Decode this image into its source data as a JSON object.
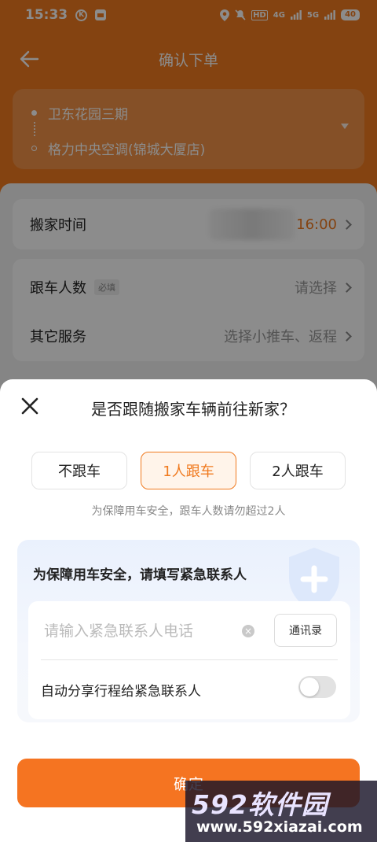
{
  "status_bar": {
    "time": "15:33",
    "network_labels": [
      "HD",
      "4G",
      "5G"
    ],
    "battery": "40"
  },
  "header": {
    "title": "确认下单"
  },
  "route": {
    "start": "卫东花园三期",
    "end": "格力中央空调(锦城大厦店)"
  },
  "move_time": {
    "label": "搬家时间",
    "value": "16:00"
  },
  "riders": {
    "label": "跟车人数",
    "required_tag": "必填",
    "value": "请选择"
  },
  "other_services": {
    "label": "其它服务",
    "value": "选择小推车、返程"
  },
  "sheet": {
    "title": "是否跟随搬家车辆前往新家？",
    "options": [
      "不跟车",
      "1人跟车",
      "2人跟车"
    ],
    "selected_option": "1人跟车",
    "tip": "为保障用车安全，跟车人数请勿超过2人",
    "contact": {
      "title": "为保障用车安全，请填写紧急联系人",
      "phone_placeholder": "请输入紧急联系人电话",
      "contacts_button": "通讯录",
      "share_label": "自动分享行程给紧急联系人",
      "share_enabled": false
    },
    "confirm": "确定"
  },
  "watermark": {
    "brand": "592软件园",
    "url": "www.592xiazai.com"
  },
  "colors": {
    "accent": "#f07a1f",
    "button": "#f57421"
  }
}
